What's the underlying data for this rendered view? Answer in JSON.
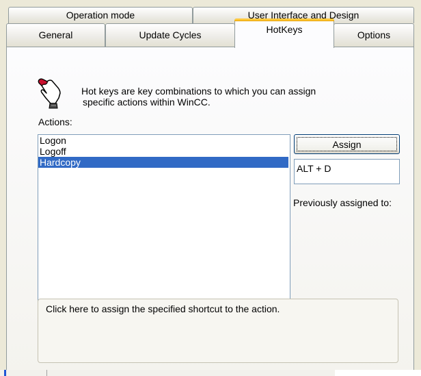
{
  "tabs_row1": [
    {
      "label": "Operation mode"
    },
    {
      "label": "User Interface and Design"
    }
  ],
  "tabs_row2": [
    {
      "label": "General"
    },
    {
      "label": "Update Cycles"
    },
    {
      "label": "HotKeys",
      "active": true
    },
    {
      "label": "Options"
    }
  ],
  "hotkeys": {
    "description_line1": "Hot keys are key combinations to which you can assign",
    "description_line2": "specific actions within WinCC.",
    "actions_label": "Actions:",
    "actions": [
      {
        "label": "Logon"
      },
      {
        "label": "Logoff"
      },
      {
        "label": "Hardcopy",
        "selected": true
      }
    ],
    "assign_label": "Assign",
    "hotkey_value": "ALT + D",
    "previously_assigned_label": "Previously assigned to:",
    "help_text": "Click here to assign the specified shortcut to the action.",
    "hand_icon": "hand-pointer-icon"
  },
  "colors": {
    "selection": "#316AC5",
    "active_tab_accent": "#FFC83C",
    "window_bg": "#ECE9D8"
  }
}
